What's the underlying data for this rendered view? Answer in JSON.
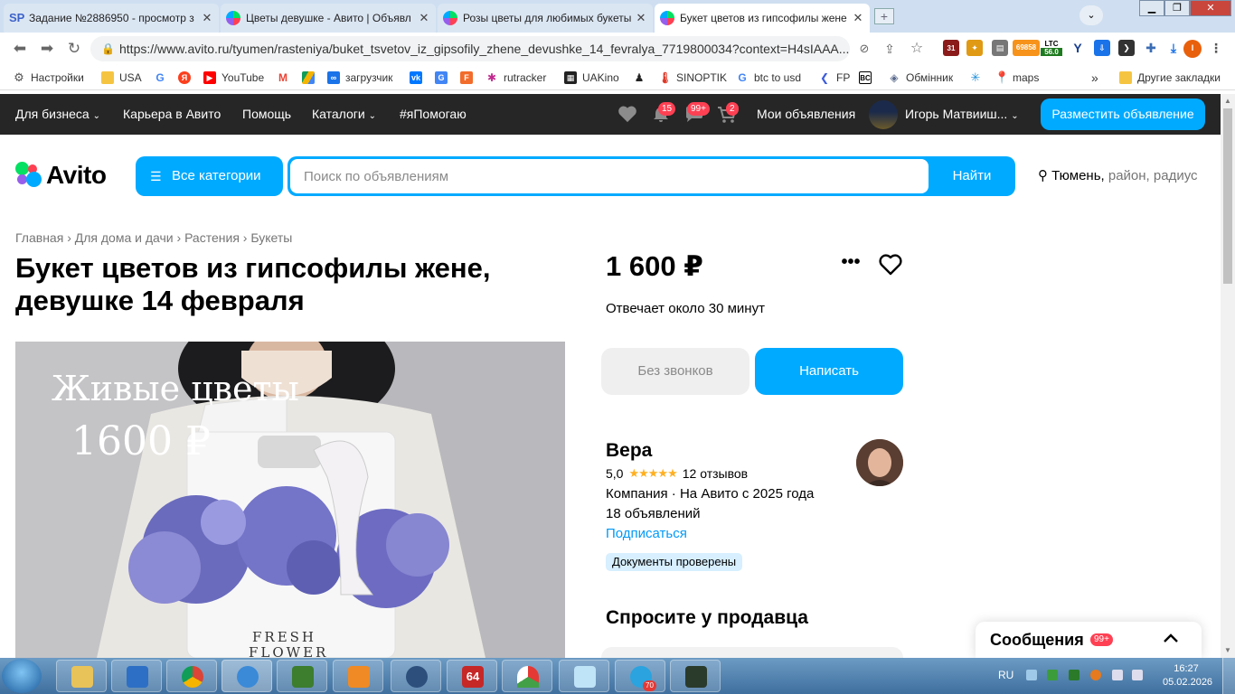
{
  "browser": {
    "tabs": [
      {
        "title": "Задание №2886950 - просмотр з",
        "favicon": "sp-icon",
        "active": false
      },
      {
        "title": "Цветы девушке - Авито | Объявл",
        "favicon": "avito-icon",
        "active": false
      },
      {
        "title": "Розы цветы для любимых букеты",
        "favicon": "avito-icon",
        "active": false
      },
      {
        "title": "Букет цветов из гипсофилы жене",
        "favicon": "avito-icon",
        "active": true
      }
    ],
    "new_tab": "+",
    "url": "https://www.avito.ru/tyumen/rasteniya/buket_tsvetov_iz_gipsofily_zhene_devushke_14_fevralya_7719800034?context=H4sIAAA...",
    "extensions": {
      "calendar_day": "31",
      "btc_value": "69858",
      "ltc_label": "LTC",
      "ltc_value": "56.0"
    },
    "profile_initial": "I",
    "bookmarks": [
      {
        "label": "Настройки",
        "icon": "gear-icon"
      },
      {
        "label": "USA",
        "icon": "folder-icon"
      },
      {
        "label": "",
        "icon": "google-icon"
      },
      {
        "label": "",
        "icon": "yandex-icon"
      },
      {
        "label": "YouTube",
        "icon": "youtube-icon"
      },
      {
        "label": "",
        "icon": "gmail-icon"
      },
      {
        "label": "",
        "icon": "drive-icon"
      },
      {
        "label": "загрузчик",
        "icon": "loader-icon"
      },
      {
        "label": "",
        "icon": "vk-icon"
      },
      {
        "label": "",
        "icon": "translate-icon"
      },
      {
        "label": "",
        "icon": "f-icon"
      },
      {
        "label": "rutracker",
        "icon": "rutracker-icon"
      },
      {
        "label": "UAKino",
        "icon": "uakino-icon"
      },
      {
        "label": "",
        "icon": "chess-icon"
      },
      {
        "label": "SINOPTIK",
        "icon": "thermometer-icon"
      },
      {
        "label": "btc to usd",
        "icon": "google-icon"
      },
      {
        "label": "FP",
        "icon": "fp-icon"
      },
      {
        "label": "",
        "icon": "bc-icon"
      },
      {
        "label": "Обмінник",
        "icon": "exchange-icon"
      },
      {
        "label": "",
        "icon": "star-icon"
      },
      {
        "label": "maps",
        "icon": "maps-icon"
      }
    ],
    "bookmarks_more": "»",
    "other_bookmarks": "Другие закладки"
  },
  "avito_header": {
    "nav": [
      "Для бизнеса",
      "Карьера в Авито",
      "Помощь",
      "Каталоги",
      "#яПомогаю"
    ],
    "notifications_count": "15",
    "messages_count": "99+",
    "cart_count": "2",
    "my_ads": "Мои объявления",
    "user_name": "Игорь Матвииш...",
    "post_ad": "Разместить объявление"
  },
  "search": {
    "logo": "Avito",
    "categories_button": "Все категории",
    "placeholder": "Поиск по объявлениям",
    "find_button": "Найти",
    "city": "Тюмень,",
    "location_extra": "район, радиус"
  },
  "listing": {
    "breadcrumbs": [
      "Главная",
      "Для дома и дачи",
      "Растения",
      "Букеты"
    ],
    "title": "Букет цветов из гипсофилы жене, девушке 14 февраля",
    "photo_text_line1": "Живые цветы",
    "photo_text_line2": "1600 ₽",
    "photo_bag_line1": "FRESH",
    "photo_bag_line2": "FLOWER",
    "price": "1 600 ₽",
    "reply_time": "Отвечает около 30 минут",
    "no_calls_button": "Без звонков",
    "write_button": "Написать"
  },
  "seller": {
    "name": "Вера",
    "rating": "5,0",
    "reviews": "12 отзывов",
    "type_since": "Компания · На Авито с 2025 года",
    "ads_count": "18 объявлений",
    "subscribe": "Подписаться",
    "verified_badge": "Документы проверены"
  },
  "ask": {
    "title": "Спросите у продавца"
  },
  "messages_widget": {
    "label": "Сообщения",
    "count": "99+"
  },
  "taskbar": {
    "telegram_count": "70",
    "app_64": "64",
    "lang": "RU",
    "time": "16:27",
    "date": "05.02.2026"
  },
  "colors": {
    "avito_blue": "#00aaff",
    "dark_bar": "#262626",
    "badge_red": "#ff4053"
  }
}
